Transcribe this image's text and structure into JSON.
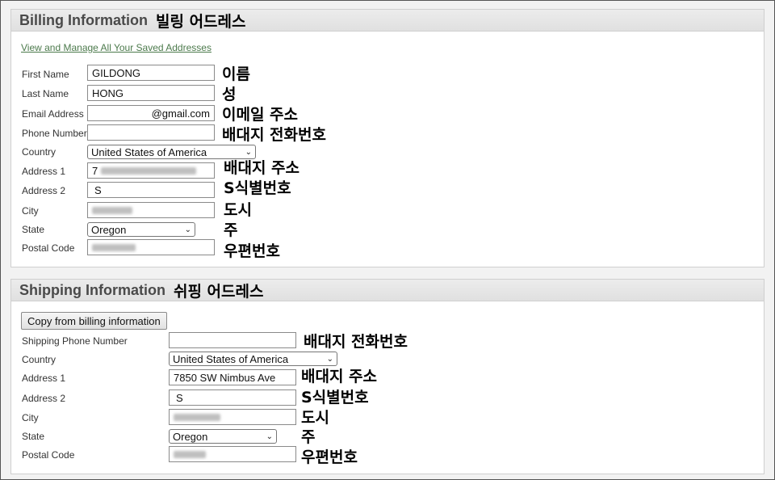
{
  "billing": {
    "title": "Billing Information",
    "title_annotation": "빌링 어드레스",
    "link": "View and Manage All Your Saved Addresses",
    "fields": {
      "first_name": {
        "label": "First Name",
        "value": "GILDONG",
        "annotation": "이름"
      },
      "last_name": {
        "label": "Last Name",
        "value": "HONG",
        "annotation": "성"
      },
      "email": {
        "label": "Email Address",
        "value": "@gmail.com",
        "annotation": "이메일 주소"
      },
      "phone": {
        "label": "Phone Number",
        "value": "",
        "annotation": "배대지 전화번호"
      },
      "country": {
        "label": "Country",
        "value": "United States of America"
      },
      "address1": {
        "label": "Address 1",
        "value": "7",
        "annotation": "배대지 주소"
      },
      "address2": {
        "label": "Address 2",
        "value": "S",
        "annotation": "S식별번호"
      },
      "city": {
        "label": "City",
        "value": "",
        "annotation": "도시"
      },
      "state": {
        "label": "State",
        "value": "Oregon",
        "annotation": "주"
      },
      "postal": {
        "label": "Postal Code",
        "value": "",
        "annotation": "우편번호"
      }
    }
  },
  "shipping": {
    "title": "Shipping Information",
    "title_annotation": "쉬핑 어드레스",
    "copy_button": "Copy from billing information",
    "fields": {
      "phone": {
        "label": "Shipping Phone Number",
        "value": "",
        "annotation": "배대지 전화번호"
      },
      "country": {
        "label": "Country",
        "value": "United States of America"
      },
      "address1": {
        "label": "Address 1",
        "value": "7850 SW Nimbus Ave",
        "annotation": "배대지 주소"
      },
      "address2": {
        "label": "Address 2",
        "value": "S",
        "annotation": "S식별번호"
      },
      "city": {
        "label": "City",
        "value": "",
        "annotation": "도시"
      },
      "state": {
        "label": "State",
        "value": "Oregon",
        "annotation": "주"
      },
      "postal": {
        "label": "Postal Code",
        "value": "",
        "annotation": "우편번호"
      }
    }
  },
  "icons": {
    "dropdown": "chevron-down-icon"
  },
  "colors": {
    "link": "#4c7a4c",
    "panel_header": "#e6e6e6"
  }
}
